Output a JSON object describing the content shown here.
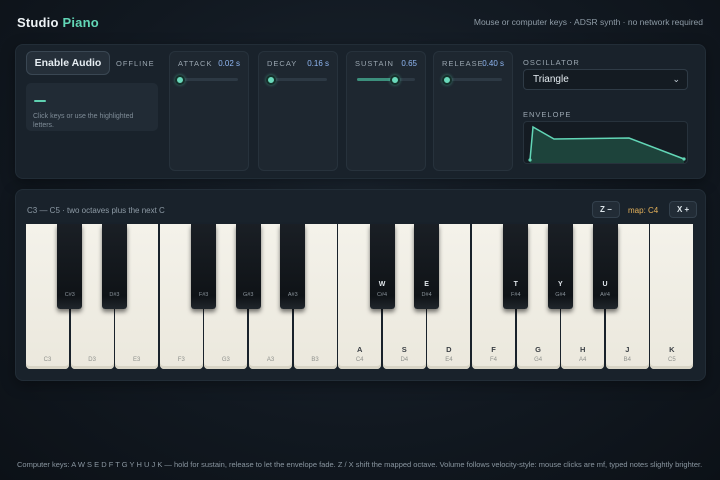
{
  "header": {
    "brand_primary": "Studio",
    "brand_accent": "Piano",
    "subtitle": "Mouse or computer keys · ADSR synth · no network required"
  },
  "audio": {
    "enable_label": "Enable Audio",
    "status": "OFFLINE",
    "hint": "Click keys or use the highlighted letters."
  },
  "adsr": [
    {
      "label": "ATTACK",
      "value": "0.02 s",
      "level": 0.0
    },
    {
      "label": "DECAY",
      "value": "0.16 s",
      "level": 0.03
    },
    {
      "label": "SUSTAIN",
      "value": "0.65",
      "level": 0.65
    },
    {
      "label": "RELEASE",
      "value": "0.40 s",
      "level": 0.05
    }
  ],
  "oscillator": {
    "label": "OSCILLATOR",
    "selected": "Triangle"
  },
  "envelope": {
    "label": "ENVELOPE"
  },
  "keyboard": {
    "caption": "C3 — C5 · two octaves plus the next C",
    "octave_down": "Z −",
    "octave_up": "X +",
    "map_label": "map: C4",
    "white_keys": [
      {
        "note": "C3",
        "key": ""
      },
      {
        "note": "D3",
        "key": ""
      },
      {
        "note": "E3",
        "key": ""
      },
      {
        "note": "F3",
        "key": ""
      },
      {
        "note": "G3",
        "key": ""
      },
      {
        "note": "A3",
        "key": ""
      },
      {
        "note": "B3",
        "key": ""
      },
      {
        "note": "C4",
        "key": "A"
      },
      {
        "note": "D4",
        "key": "S"
      },
      {
        "note": "E4",
        "key": "D"
      },
      {
        "note": "F4",
        "key": "F"
      },
      {
        "note": "G4",
        "key": "G"
      },
      {
        "note": "A4",
        "key": "H"
      },
      {
        "note": "B4",
        "key": "J"
      },
      {
        "note": "C5",
        "key": "K"
      }
    ],
    "black_keys": [
      {
        "note": "C#3",
        "key": "",
        "after": 0
      },
      {
        "note": "D#3",
        "key": "",
        "after": 1
      },
      {
        "note": "F#3",
        "key": "",
        "after": 3
      },
      {
        "note": "G#3",
        "key": "",
        "after": 4
      },
      {
        "note": "A#3",
        "key": "",
        "after": 5
      },
      {
        "note": "C#4",
        "key": "W",
        "after": 7
      },
      {
        "note": "D#4",
        "key": "E",
        "after": 8
      },
      {
        "note": "F#4",
        "key": "T",
        "after": 10
      },
      {
        "note": "G#4",
        "key": "Y",
        "after": 11
      },
      {
        "note": "A#4",
        "key": "U",
        "after": 12
      }
    ]
  },
  "footer": "Computer keys: A W S E D F T G Y H U J K — hold for sustain, release to let the envelope fade. Z / X shift the mapped octave. Volume follows velocity-style: mouse clicks are mf, typed notes slightly brighter.",
  "colors": {
    "accent": "#62d6b6",
    "value_blue": "#8fb6f2",
    "map_orange": "#e6b25a"
  }
}
